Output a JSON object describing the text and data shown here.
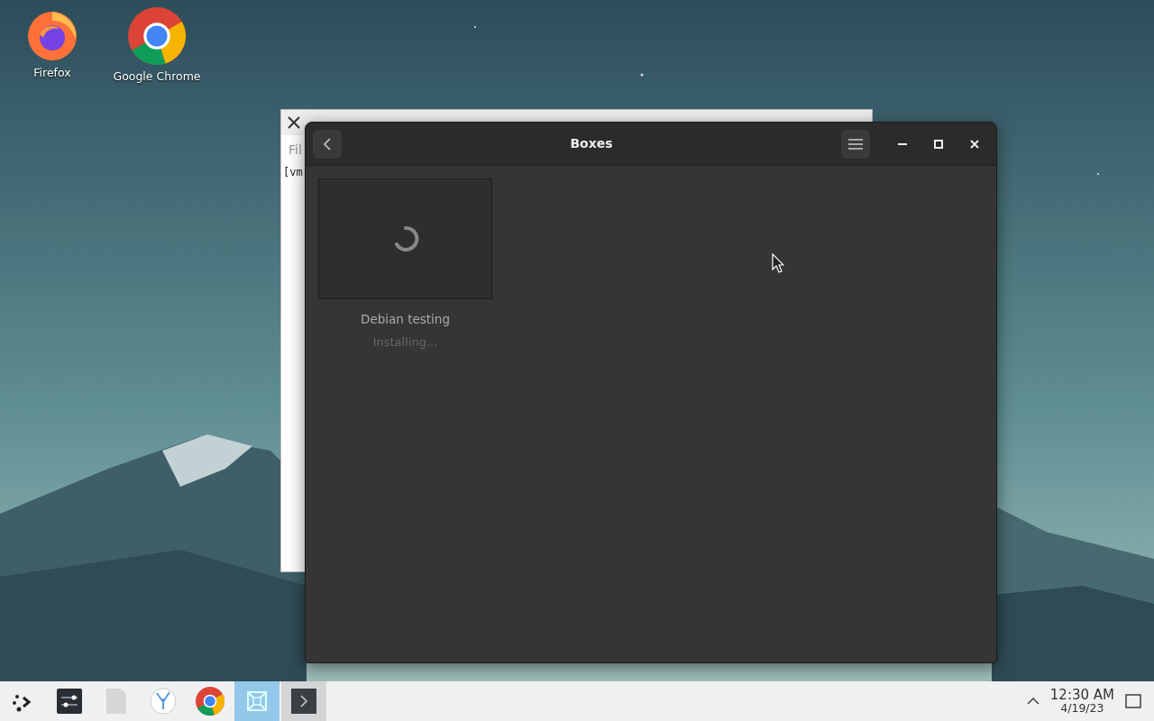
{
  "desktop_icons": [
    {
      "kind": "firefox",
      "label": "Firefox"
    },
    {
      "kind": "chrome",
      "label": "Google Chrome"
    }
  ],
  "terminal_window": {
    "menu_text": "Fil",
    "line": "[vm"
  },
  "boxes_window": {
    "title": "Boxes",
    "machines": [
      {
        "name": "Debian testing",
        "status": "Installing..."
      }
    ]
  },
  "taskbar": {
    "tasks": [
      {
        "kind": "launcher",
        "selected": false,
        "open": false
      },
      {
        "kind": "settings",
        "selected": false,
        "open": false
      },
      {
        "kind": "file",
        "selected": false,
        "open": false
      },
      {
        "kind": "coral",
        "selected": false,
        "open": false
      },
      {
        "kind": "chrome",
        "selected": false,
        "open": false
      },
      {
        "kind": "boxes",
        "selected": true,
        "open": true
      },
      {
        "kind": "terminal",
        "selected": false,
        "open": true
      }
    ],
    "clock": {
      "time": "12:30 AM",
      "date": "4/19/23"
    }
  }
}
